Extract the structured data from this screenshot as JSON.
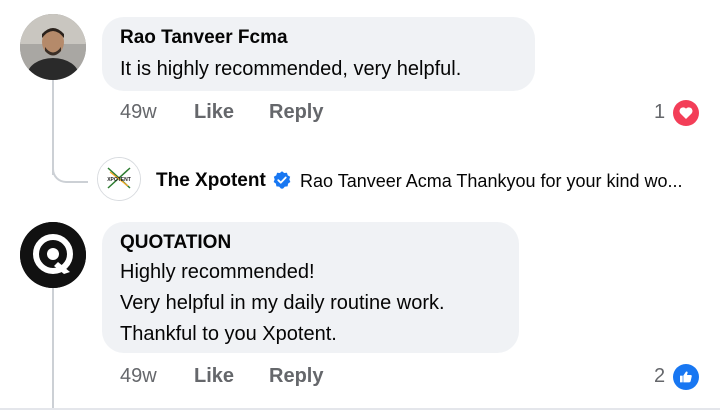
{
  "comments": [
    {
      "author": "Rao Tanveer Fcma",
      "lines": [
        "It is highly recommended, very helpful."
      ],
      "time": "49w",
      "like_label": "Like",
      "reply_label": "Reply",
      "reaction_count": "1",
      "reaction_icon": "love-heart-icon",
      "reaction_color": "#f33e58"
    },
    {
      "author": "QUOTATION",
      "lines": [
        "Highly recommended!",
        "Very helpful in my daily routine work.",
        "Thankful to you Xpotent."
      ],
      "time": "49w",
      "like_label": "Like",
      "reply_label": "Reply",
      "reaction_count": "2",
      "reaction_icon": "like-thumb-icon",
      "reaction_color": "#1877f2"
    }
  ],
  "reply": {
    "author": "The Xpotent",
    "text": "Rao Tanveer Acma Thankyou for your kind wo...",
    "verified_icon": "verified-badge-icon",
    "avatar_text": "XPOTENT"
  },
  "colors": {
    "bubble": "#f0f2f5",
    "secondary_text": "#65676b",
    "verified": "#1877f2"
  }
}
